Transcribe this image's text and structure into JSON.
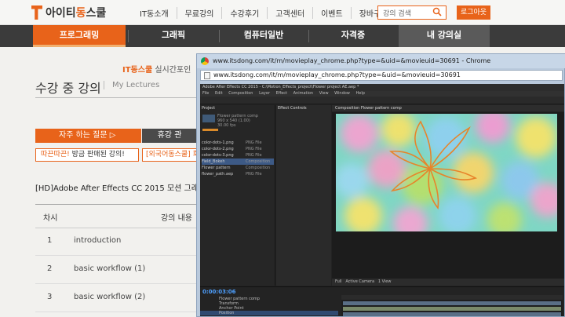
{
  "site": {
    "logo": {
      "prefix": "아이티",
      "highlight": "동",
      "suffix": "스쿨"
    },
    "top_menu": [
      "IT동소개",
      "무료강의",
      "수강후기",
      "고객센터",
      "이벤트",
      "장바구니"
    ],
    "search_placeholder": "강의 검색",
    "logout_label": "로그아웃",
    "categories": [
      "프로그래밍",
      "그래픽",
      "컴퓨터일반",
      "자격증",
      "내 강의실"
    ],
    "banner_highlight": "IT동스쿨",
    "banner_text": " 실시간포인",
    "page_title": "수강 중 강의",
    "page_subtitle": "My Lectures",
    "faq_label": "자주 하는 질문 ▷",
    "cut_label": "휴강 관",
    "tag1_highlight": "따끈따끈!",
    "tag1_text": " 방금 판매된 강의!",
    "tag2_text": "[외국어동스쿨] 회",
    "course_title": "[HD]Adobe After Effects CC 2015 모션 그래픽의",
    "col_num": "차시",
    "col_content": "강의 내용",
    "lessons": [
      {
        "num": "1",
        "name": "introduction"
      },
      {
        "num": "2",
        "name": "basic workflow (1)"
      },
      {
        "num": "3",
        "name": "basic workflow (2)"
      }
    ]
  },
  "popup": {
    "window_title": "www.itsdong.com/it/m/movieplay_chrome.php?type=&uid=&movieuid=30691 - Chrome",
    "url": "www.itsdong.com/it/m/movieplay_chrome.php?type=&uid=&movieuid=30691"
  },
  "ae": {
    "title": "Adobe After Effects CC 2015 - C:\\Motion_Effects_project\\Flower project AE.aep *",
    "menu": [
      "File",
      "Edit",
      "Composition",
      "Layer",
      "Effect",
      "Animation",
      "View",
      "Window",
      "Help"
    ],
    "project_tab": "Project",
    "proj_name": "Flower pattern comp",
    "proj_info": "960 x 540 (1.00)",
    "proj_fps": "30.00 fps",
    "items": [
      {
        "name": "color-dots-1.png",
        "type": "PNG File"
      },
      {
        "name": "color-dots-2.png",
        "type": "PNG File"
      },
      {
        "name": "color-dots-3.png",
        "type": "PNG File"
      },
      {
        "name": "Field_Bokeh",
        "type": "Composition"
      },
      {
        "name": "Flower pattern",
        "type": "Composition"
      },
      {
        "name": "flower_path.aep",
        "type": "PNG File"
      }
    ],
    "effects_label": "Effect Controls",
    "comp_tab": "Composition  Flower pattern comp",
    "view_zoom": "Full",
    "view_camera": "Active Camera",
    "view_views": "1 View",
    "timecode": "0:00:03:06",
    "layers": [
      "Flower pattern comp",
      "Transform",
      "Anchor Point",
      "Position",
      "Scale",
      "Rotation",
      "Opacity",
      "COLOR 1 (BG)",
      "[field_Bokeh]"
    ]
  }
}
